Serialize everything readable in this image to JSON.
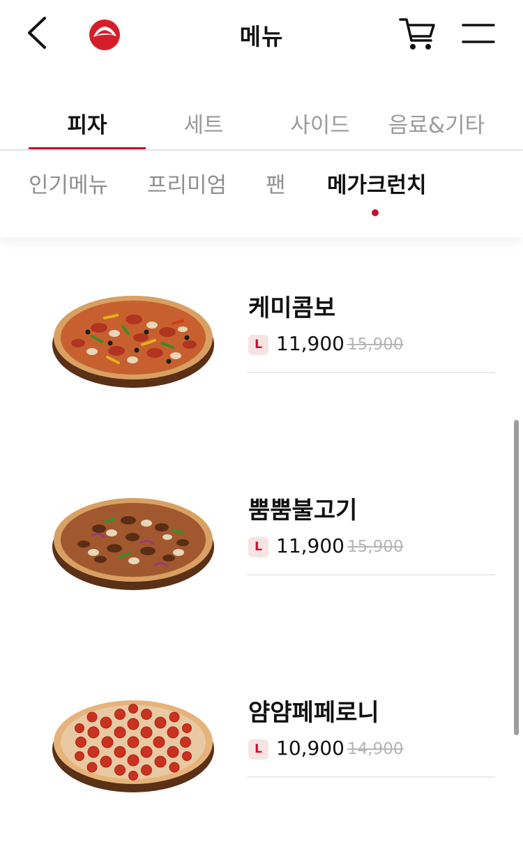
{
  "header": {
    "title": "메뉴",
    "back_icon": "chevron-left-icon",
    "logo": "pizza-hut-logo",
    "cart_icon": "cart-icon",
    "menu_icon": "hamburger-menu-icon"
  },
  "category_tabs": [
    {
      "label": "피자",
      "active": true
    },
    {
      "label": "세트",
      "active": false
    },
    {
      "label": "사이드",
      "active": false
    },
    {
      "label": "음료&기타",
      "active": false
    }
  ],
  "sub_tabs": [
    {
      "label": "인기메뉴",
      "active": false
    },
    {
      "label": "프리미엄",
      "active": false
    },
    {
      "label": "팬",
      "active": false
    },
    {
      "label": "메가크런치",
      "active": true
    }
  ],
  "products": [
    {
      "name": "케미콤보",
      "size": "L",
      "price": "11,900",
      "original_price": "15,900"
    },
    {
      "name": "뿜뿜불고기",
      "size": "L",
      "price": "11,900",
      "original_price": "15,900"
    },
    {
      "name": "얌얌페페로니",
      "size": "L",
      "price": "10,900",
      "original_price": "14,900"
    }
  ],
  "colors": {
    "accent": "#c8102e",
    "badge_bg": "#f7e3e4",
    "muted_text": "#9a9a9a",
    "strike_text": "#b5b5b5"
  }
}
